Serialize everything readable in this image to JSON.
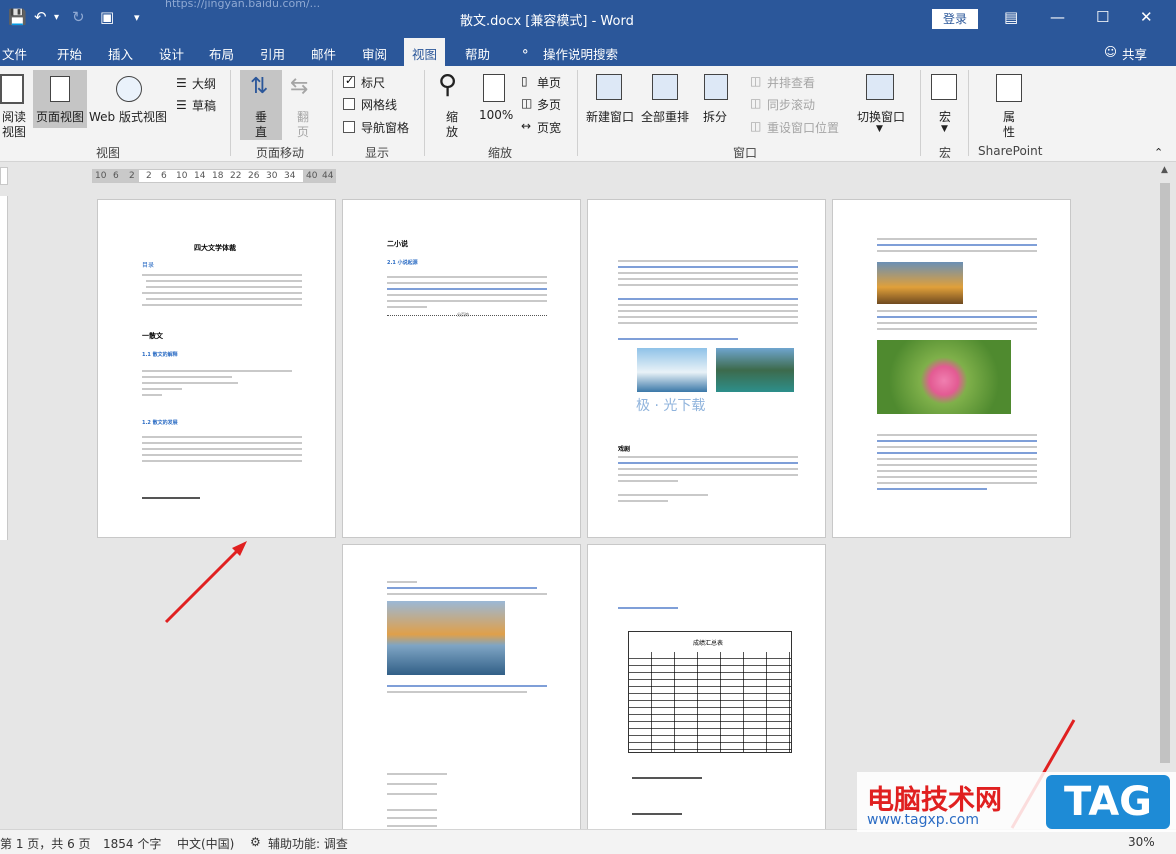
{
  "titlebar": {
    "doc_title": "散文.docx [兼容模式]  -  Word",
    "url_ghost": "https://jingyan.baidu.com/...",
    "login": "登录"
  },
  "tabs": [
    "文件",
    "开始",
    "插入",
    "设计",
    "布局",
    "引用",
    "邮件",
    "审阅",
    "视图",
    "帮助",
    "操作说明搜索"
  ],
  "active_tab": "视图",
  "share": "共享",
  "ribbon": {
    "read_mode": [
      "阅读",
      "视图"
    ],
    "print_layout": "页面视图",
    "web_layout": "Web 版式视图",
    "outline": "大纲",
    "draft": "草稿",
    "group_view": "视图",
    "vertical": [
      "垂",
      "直"
    ],
    "flip": [
      "翻",
      "页"
    ],
    "group_page_move": "页面移动",
    "ruler": "标尺",
    "gridlines": "网格线",
    "nav_pane": "导航窗格",
    "group_show": "显示",
    "zoom": [
      "缩",
      "放"
    ],
    "hundred": "100%",
    "one_page": "单页",
    "multi_page": "多页",
    "page_width": "页宽",
    "group_zoom": "缩放",
    "new_window": "新建窗口",
    "arrange_all": "全部重排",
    "split": "拆分",
    "side_by_side": "并排查看",
    "sync_scroll": "同步滚动",
    "reset_pos": "重设窗口位置",
    "switch_window": "切换窗口",
    "group_window": "窗口",
    "macro": "宏",
    "group_macro": "宏",
    "properties": [
      "属",
      "性"
    ],
    "group_sharepoint": "SharePoint"
  },
  "ruler_ticks": [
    "10",
    "6",
    "2",
    "2",
    "6",
    "10",
    "14",
    "18",
    "22",
    "26",
    "30",
    "34",
    "40",
    "44"
  ],
  "pages": {
    "p1_title": "四大文学体裁",
    "p1_toc": "目录",
    "p1_h1": "一散文",
    "p1_h2a": "1.1 散文的解释",
    "p1_h2b": "1.2 散文的发展",
    "p2_h1": "二小说",
    "p2_h2": "2.1 小说起源",
    "p2_sec": "分页符",
    "p3_big": "极 · 光下载",
    "p3_h": "戏剧",
    "p6_table_title": "成绩汇总表"
  },
  "status": {
    "page_info": "第 1 页，共 6 页",
    "word_count": "1854 个字",
    "language": "中文(中国)",
    "accessibility": "辅助功能: 调查",
    "zoom": "30%"
  },
  "watermark": {
    "main": "电脑技术网",
    "url": "www.tagxp.com",
    "tag": "TAG"
  },
  "colors": {
    "brand": "#2b579a",
    "arrow": "#e02020"
  }
}
